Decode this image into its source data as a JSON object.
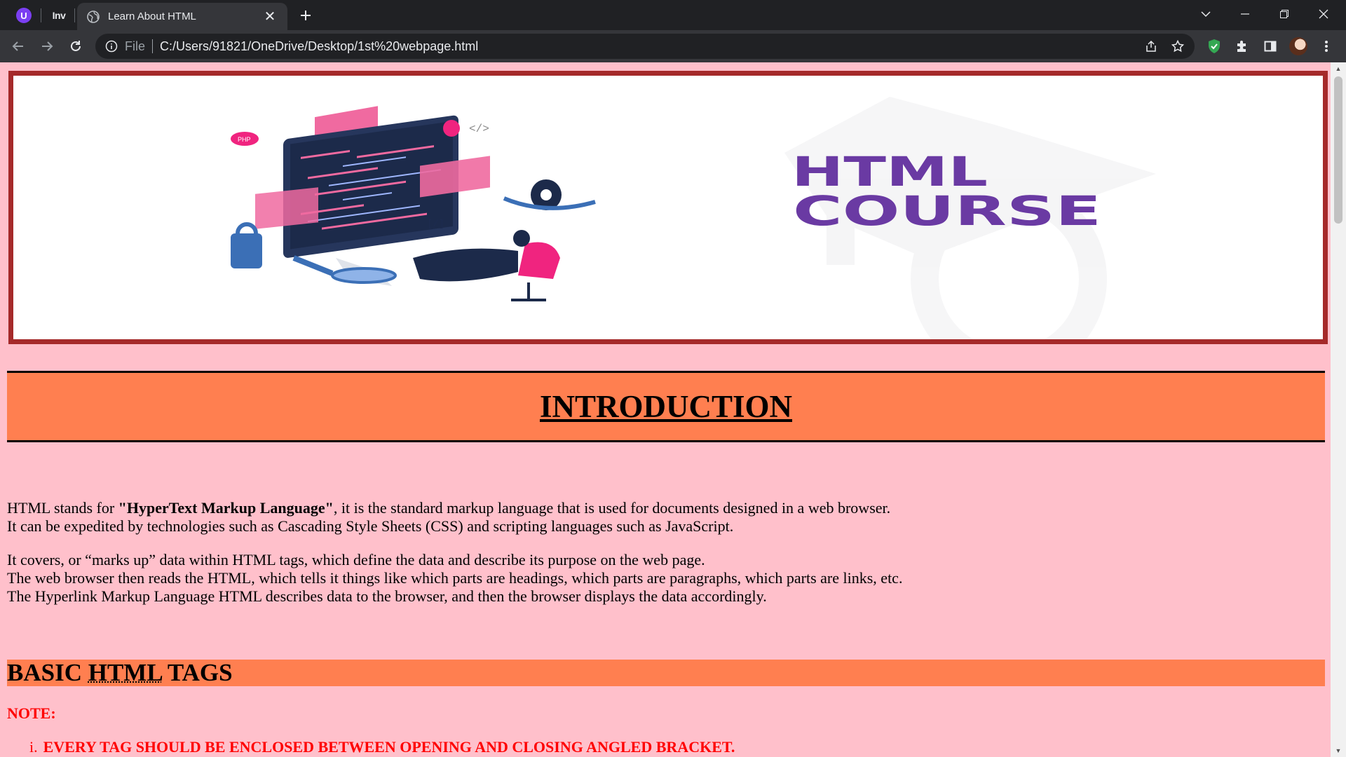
{
  "browser": {
    "tab": {
      "title": "Learn About HTML"
    },
    "pinned": {
      "first_icon": "extension-u-icon",
      "second_label": "Inv"
    },
    "omnibox": {
      "scheme": "File",
      "url": "C:/Users/91821/OneDrive/Desktop/1st%20webpage.html"
    }
  },
  "page": {
    "banner": {
      "line1": "HTML",
      "line2": "COURSE",
      "bracket": "[/]",
      "code_tag": "</>",
      "php": "PHP"
    },
    "intro": {
      "heading": "INTRODUCTION"
    },
    "paragraph1": {
      "before": "HTML stands for ",
      "bold": "\"HyperText Markup Language\"",
      "after": ", it is the standard markup language that is used for documents designed in a web browser.",
      "line2": "It can be expedited by technologies such as Cascading Style Sheets (CSS) and scripting languages such as JavaScript."
    },
    "paragraph2": {
      "line1": "It covers, or “marks up” data within HTML tags, which define the data and describe its purpose on the web page.",
      "line2": "The web browser then reads the HTML, which tells it things like which parts are headings, which parts are paragraphs, which parts are links, etc.",
      "line3": "The Hyperlink Markup Language HTML describes data to the browser, and then the browser displays the data accordingly."
    },
    "basic_tags": {
      "word1": "BASIC",
      "abbr": "HTML",
      "word2": "TAGS"
    },
    "note": "NOTE:",
    "rules": [
      {
        "num": "i.",
        "text": "EVERY TAG SHOULD BE ENCLOSED BETWEEN OPENING AND CLOSING ANGLED BRACKET."
      }
    ]
  },
  "colors": {
    "page_bg": "#ffc0cb",
    "banner_border": "#a52a2a",
    "heading_bg": "#ff7f50",
    "note_red": "#ff0000",
    "course_purple": "#6a3aa3"
  }
}
